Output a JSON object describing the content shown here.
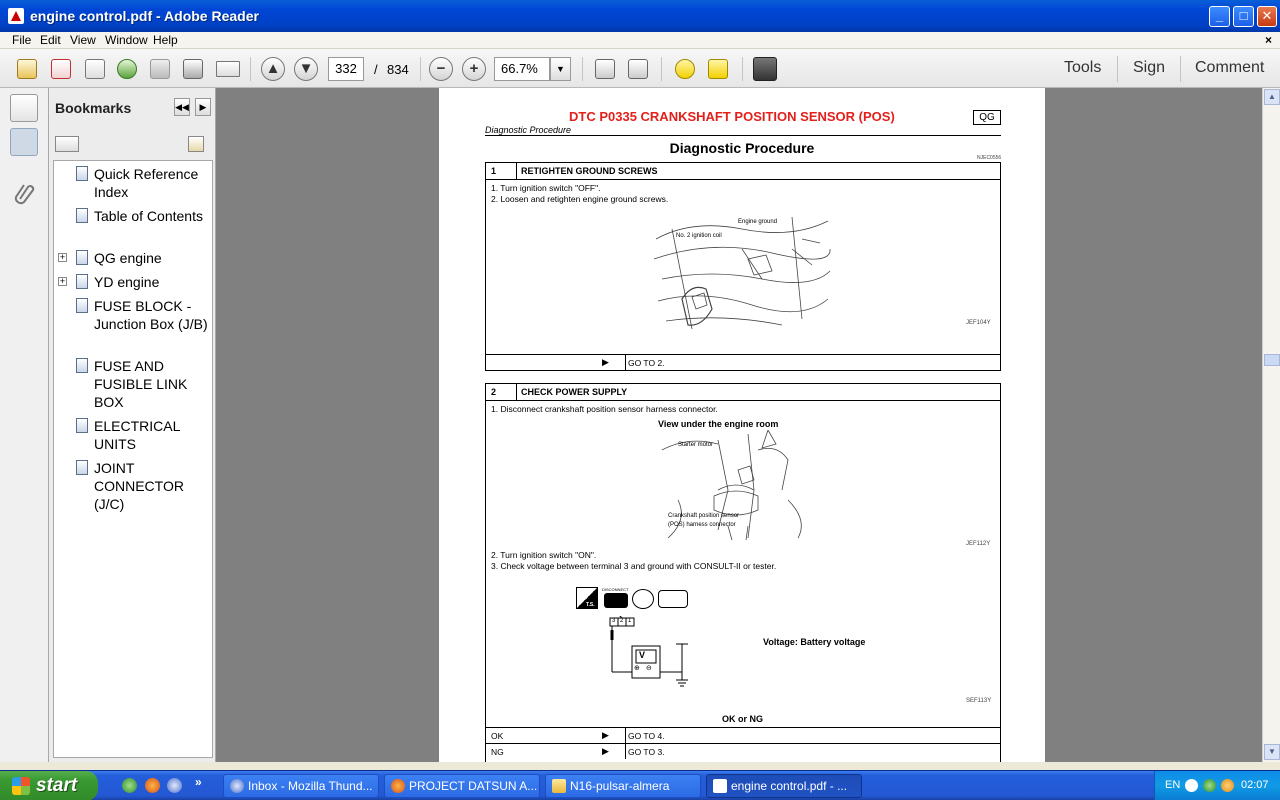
{
  "window": {
    "title": "engine control.pdf - Adobe Reader",
    "minimize": "_",
    "maximize": "□",
    "close": "✕"
  },
  "menu": {
    "items": [
      "File",
      "Edit",
      "View",
      "Window",
      "Help"
    ],
    "close_doc": "×"
  },
  "toolbar": {
    "page_number": "332",
    "page_separator": "/",
    "page_total": "834",
    "zoom": "66.7%",
    "tools_label": "Tools",
    "sign_label": "Sign",
    "comment_label": "Comment"
  },
  "bookmarks": {
    "header": "Bookmarks",
    "items": [
      {
        "label": "Quick Reference Index",
        "expandable": false
      },
      {
        "label": "Table of Contents",
        "expandable": false
      },
      {
        "label": "QG engine",
        "expandable": true
      },
      {
        "label": "YD engine",
        "expandable": true
      },
      {
        "label": "FUSE BLOCK - Junction Box (J/B)",
        "expandable": false
      },
      {
        "label": "FUSE AND FUSIBLE LINK BOX",
        "expandable": false
      },
      {
        "label": "ELECTRICAL UNITS",
        "expandable": false
      },
      {
        "label": "JOINT CONNECTOR (J/C)",
        "expandable": false
      }
    ]
  },
  "document": {
    "page_title": "DTC P0335 CRANKSHAFT POSITION SENSOR (POS)",
    "section_tag": "QG",
    "subtitle": "Diagnostic Procedure",
    "heading": "Diagnostic Procedure",
    "ref_code": "NJEC0556",
    "steps": [
      {
        "number": "1",
        "title": "RETIGHTEN GROUND SCREWS",
        "instructions": [
          "1.  Turn ignition switch \"OFF\".",
          "2.  Loosen and retighten engine ground screws."
        ],
        "figure_labels": [
          "Engine ground",
          "No. 2 ignition coil"
        ],
        "figure_code": "JEF104Y",
        "results": [
          {
            "label": "",
            "arrow": "▶",
            "action": "GO TO 2."
          }
        ]
      },
      {
        "number": "2",
        "title": "CHECK POWER SUPPLY",
        "instructions": [
          "1.  Disconnect crankshaft position sensor harness connector."
        ],
        "figure_title": "View under the engine room",
        "figure_labels": [
          "Starter motor",
          "Crankshaft position sensor",
          "(POS) harness connector"
        ],
        "figure_code": "JEF112Y",
        "instructions2": [
          "2.  Turn ignition switch \"ON\".",
          "3.  Check voltage between terminal 3 and ground with CONSULT-II or tester."
        ],
        "tester_labels": [
          "DISCONNECT",
          "T.S.",
          "3",
          "2",
          "1",
          "V",
          "⊕",
          "⊖"
        ],
        "voltage_text": "Voltage: Battery voltage",
        "figure2_code": "SEF113Y",
        "ok_ng": "OK or NG",
        "results": [
          {
            "label": "OK",
            "arrow": "▶",
            "action": "GO TO 4."
          },
          {
            "label": "NG",
            "arrow": "▶",
            "action": "GO TO 3."
          }
        ]
      }
    ]
  },
  "taskbar": {
    "start_label": "start",
    "chevron": "»",
    "tasks": [
      {
        "label": "Inbox - Mozilla Thund...",
        "active": false
      },
      {
        "label": "PROJECT DATSUN A...",
        "active": false
      },
      {
        "label": "N16-pulsar-almera",
        "active": false
      },
      {
        "label": "engine control.pdf - ...",
        "active": true
      }
    ],
    "language": "EN",
    "clock": "02:07"
  },
  "colors": {
    "title_bar": "#0046d5",
    "doc_background": "#808080",
    "page_title_red": "#e3201b",
    "taskbar": "#245edb",
    "start_green": "#3a9a32"
  }
}
